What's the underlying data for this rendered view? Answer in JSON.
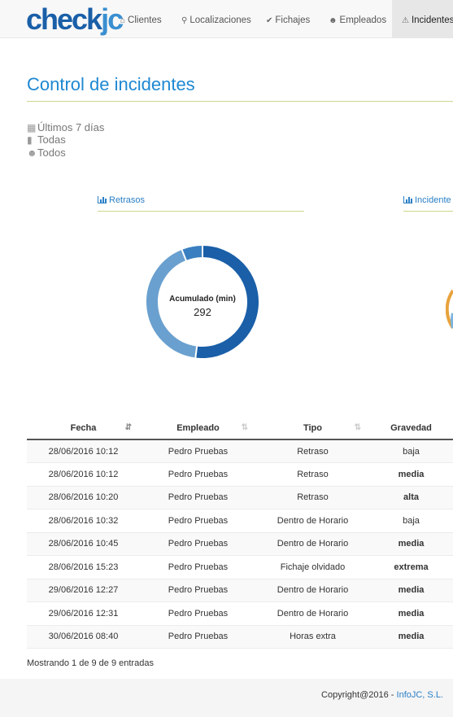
{
  "brand": {
    "logo": "checkjc"
  },
  "nav": {
    "items": [
      {
        "icon": "home-icon",
        "glyph": "⌂",
        "label": "Clientes"
      },
      {
        "icon": "map-marker-icon",
        "glyph": "⚲",
        "label": "Localizaciones"
      },
      {
        "icon": "check-icon",
        "glyph": "✔",
        "label": "Fichajes"
      },
      {
        "icon": "user-icon",
        "glyph": "☻",
        "label": "Empleados"
      },
      {
        "icon": "warning-icon",
        "glyph": "⚠",
        "label": "Incidentes"
      }
    ],
    "active": "Incidentes"
  },
  "page": {
    "title": "Control de incidentes"
  },
  "filters": [
    {
      "icon": "calendar-icon",
      "glyph": "▦",
      "value": "Últimos 7 días"
    },
    {
      "icon": "building-icon",
      "glyph": "▮",
      "value": "Todas"
    },
    {
      "icon": "user-icon",
      "glyph": "☻",
      "value": "Todos"
    }
  ],
  "panels": {
    "retrasos": {
      "title": "Retrasos"
    },
    "incidentes": {
      "title": "Incidente"
    }
  },
  "donut": {
    "label": "Acumulado (min)",
    "value": "292",
    "segments": [
      {
        "fraction": 0.52,
        "color": "#1a5fa8"
      },
      {
        "fraction": 0.42,
        "color": "#6aa0cf"
      },
      {
        "fraction": 0.06,
        "color": "#3a7fc0"
      }
    ]
  },
  "table": {
    "headers": [
      "Fecha",
      "Empleado",
      "Tipo",
      "Gravedad"
    ],
    "rows": [
      [
        "28/06/2016 10:12",
        "Pedro Pruebas",
        "Retraso",
        "baja"
      ],
      [
        "28/06/2016 10:12",
        "Pedro Pruebas",
        "Retraso",
        "media"
      ],
      [
        "28/06/2016 10:20",
        "Pedro Pruebas",
        "Retraso",
        "alta"
      ],
      [
        "28/06/2016 10:32",
        "Pedro Pruebas",
        "Dentro de Horario",
        "baja"
      ],
      [
        "28/06/2016 10:45",
        "Pedro Pruebas",
        "Dentro de Horario",
        "media"
      ],
      [
        "28/06/2016 15:23",
        "Pedro Pruebas",
        "Fichaje olvidado",
        "extrema"
      ],
      [
        "29/06/2016 12:27",
        "Pedro Pruebas",
        "Dentro de Horario",
        "media"
      ],
      [
        "29/06/2016 12:31",
        "Pedro Pruebas",
        "Dentro de Horario",
        "media"
      ],
      [
        "30/06/2016 08:40",
        "Pedro Pruebas",
        "Horas extra",
        "media"
      ]
    ],
    "info": "Mostrando 1 de 9 de 9 entradas"
  },
  "footer": {
    "text": "Copyright@2016 - ",
    "link": "InfoJC, S.L."
  },
  "colors": {
    "accent": "#1e88d2",
    "rule": "#c8d98e",
    "baja": "#7ab4e0",
    "media": "#e8a33d",
    "alta": "#d43f3a",
    "extrema": "#222222"
  }
}
